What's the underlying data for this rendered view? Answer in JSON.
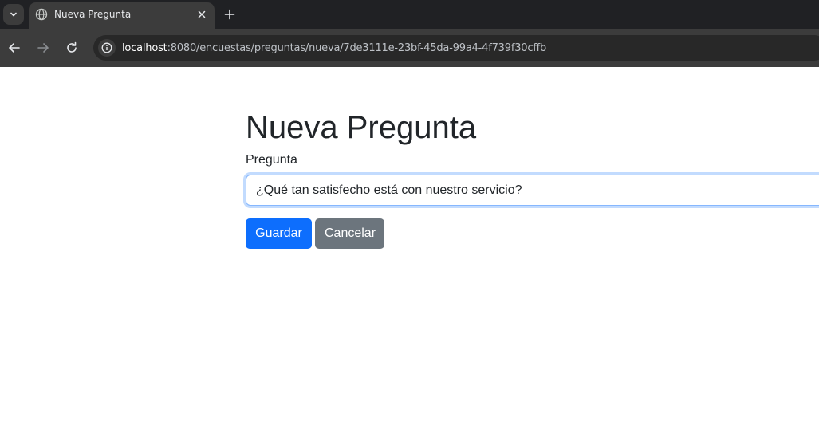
{
  "browser": {
    "tab": {
      "title": "Nueva Pregunta",
      "favicon": "globe-icon"
    },
    "address": {
      "host": "localhost",
      "path": ":8080/encuestas/preguntas/nueva/7de3111e-23bf-45da-99a4-4f739f30cffb"
    }
  },
  "form": {
    "title": "Nueva Pregunta",
    "field_label": "Pregunta",
    "field_value": "¿Qué tan satisfecho está con nuestro servicio?",
    "save_label": "Guardar",
    "cancel_label": "Cancelar"
  },
  "colors": {
    "primary": "#0d6efd",
    "secondary": "#6c757d",
    "focus_border": "#86b7fe"
  }
}
